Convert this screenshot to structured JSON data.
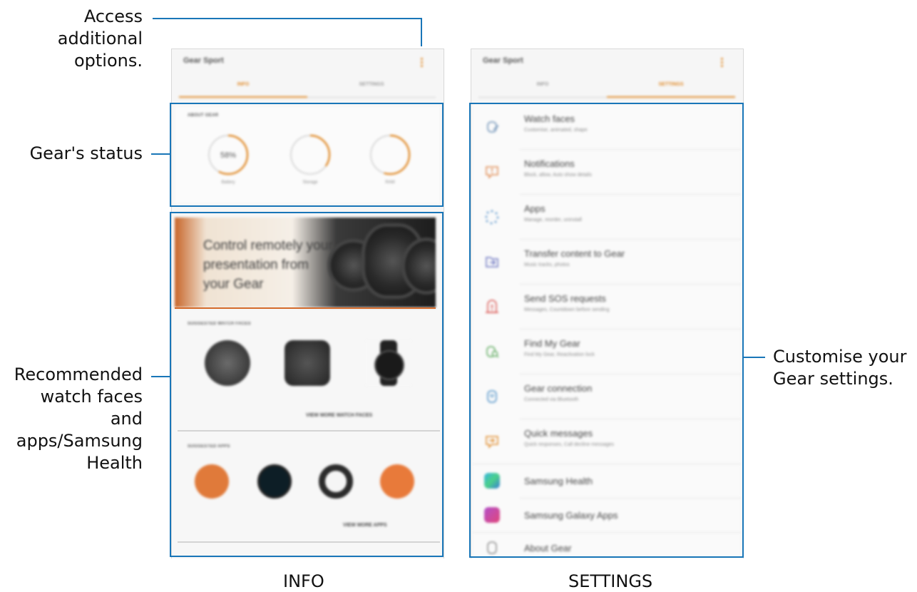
{
  "callouts": {
    "access": "Access additional options.",
    "status": "Gear's status",
    "recommended": "Recommended watch faces and apps/Samsung Health",
    "customise": "Customise your Gear settings."
  },
  "labels": {
    "info": "INFO",
    "settings": "SETTINGS"
  },
  "info_screen": {
    "app_title": "Gear Sport",
    "tabs": [
      "INFO",
      "SETTINGS"
    ],
    "active_tab": "INFO",
    "about_gear": {
      "title": "ABOUT GEAR",
      "rings": [
        {
          "value": "58%",
          "label": "Battery",
          "sub": "",
          "fraction": 0.58
        },
        {
          "value": "",
          "label": "Storage",
          "sub": "",
          "fraction": 0.35
        },
        {
          "value": "",
          "label": "RAM",
          "sub": "",
          "fraction": 0.55
        }
      ]
    },
    "banner_text": "Control remotely your presentation from your Gear",
    "watch_faces": {
      "title": "SUGGESTED WATCH FACES",
      "items": [
        "",
        "",
        ""
      ],
      "more": "VIEW MORE WATCH FACES"
    },
    "apps": {
      "title": "SUGGESTED APPS",
      "items": [
        "",
        "",
        "",
        ""
      ],
      "more": "VIEW MORE APPS"
    },
    "colors": {
      "accent": "#e08a28",
      "highlight": "#1976b8"
    }
  },
  "settings_screen": {
    "app_title": "Gear Sport",
    "tabs": [
      "INFO",
      "SETTINGS"
    ],
    "active_tab": "SETTINGS",
    "rows": [
      {
        "title": "Watch faces",
        "subtitle": "Customise, animated, shape",
        "icon": "watch-face-icon"
      },
      {
        "title": "Notifications",
        "subtitle": "Block, allow, Auto show details",
        "icon": "notifications-icon"
      },
      {
        "title": "Apps",
        "subtitle": "Manage, reorder, uninstall",
        "icon": "apps-icon"
      },
      {
        "title": "Transfer content to Gear",
        "subtitle": "Music tracks, photos",
        "icon": "transfer-icon"
      },
      {
        "title": "Send SOS requests",
        "subtitle": "Messages, Countdown before sending",
        "icon": "sos-icon"
      },
      {
        "title": "Find My Gear",
        "subtitle": "Find My Gear, Reactivation lock",
        "icon": "find-gear-icon"
      },
      {
        "title": "Gear connection",
        "subtitle": "Connected via Bluetooth",
        "icon": "connection-icon"
      },
      {
        "title": "Quick messages",
        "subtitle": "Quick responses, Call decline messages",
        "icon": "quick-messages-icon"
      },
      {
        "title": "Samsung Health",
        "subtitle": "",
        "icon": "samsung-health-icon"
      },
      {
        "title": "Samsung Galaxy Apps",
        "subtitle": "",
        "icon": "galaxy-apps-icon"
      },
      {
        "title": "About Gear",
        "subtitle": "",
        "icon": "about-gear-icon"
      }
    ]
  }
}
